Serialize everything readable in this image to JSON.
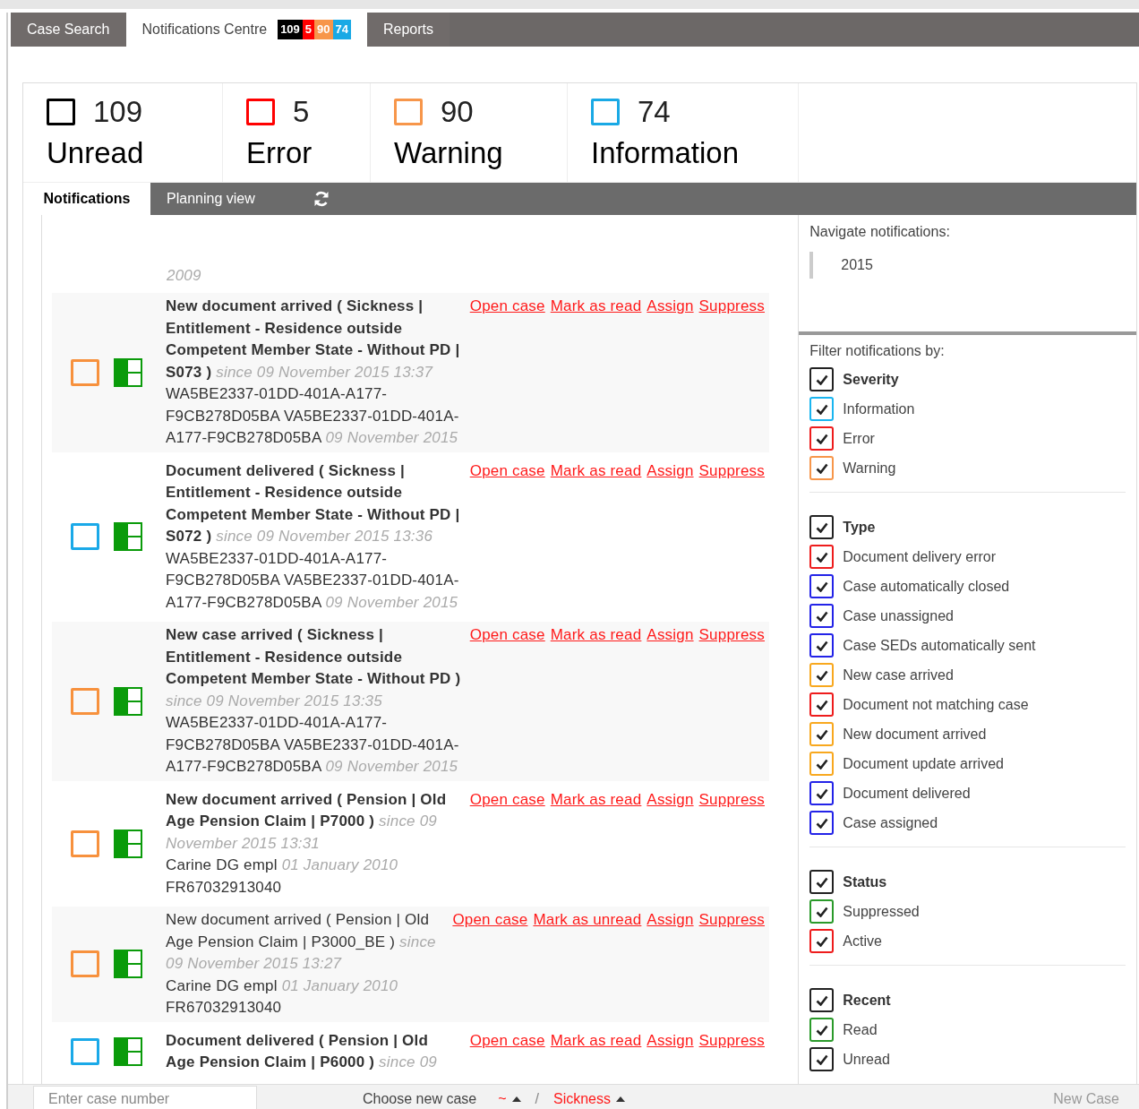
{
  "top_tabs": [
    {
      "label": "Case Search",
      "selected": false
    },
    {
      "label": "Notifications Centre",
      "selected": true,
      "badges": [
        {
          "text": "109",
          "color": "#000000"
        },
        {
          "text": "5",
          "color": "#ff0000"
        },
        {
          "text": "90",
          "color": "#f7964a"
        },
        {
          "text": "74",
          "color": "#19a9e5"
        }
      ]
    },
    {
      "label": "Reports",
      "selected": false
    }
  ],
  "stats": [
    {
      "count": "109",
      "label": "Unread",
      "color": "#000000"
    },
    {
      "count": "5",
      "label": "Error",
      "color": "#ff0000"
    },
    {
      "count": "90",
      "label": "Warning",
      "color": "#f7964a"
    },
    {
      "count": "74",
      "label": "Information",
      "color": "#19a9e5"
    }
  ],
  "sub_tabs": [
    {
      "label": "Notifications",
      "selected": true
    },
    {
      "label": "Planning view",
      "selected": false
    }
  ],
  "list_top_fragment": {
    "date": "2009"
  },
  "notifications": [
    {
      "color": "#f7913d",
      "unread": true,
      "title": "New document arrived ( Sickness | Entitlement - Residence outside Competent Member State - Without PD | S073 )",
      "since": "since 09 November 2015 13:37",
      "details": [
        {
          "text": "WA5BE2337-01DD-401A-A177-F9CB278D05BA VA5BE2337-01DD-401A-A177-F9CB278D05BA",
          "date": "09 November 2015"
        }
      ],
      "actions": [
        "Open case",
        "Mark as read",
        "Assign",
        "Suppress"
      ]
    },
    {
      "color": "#1aa9e8",
      "unread": true,
      "title": "Document delivered ( Sickness | Entitlement - Residence outside Competent Member State - Without PD | S072 )",
      "since": "since 09 November 2015 13:36",
      "details": [
        {
          "text": "WA5BE2337-01DD-401A-A177-F9CB278D05BA VA5BE2337-01DD-401A-A177-F9CB278D05BA",
          "date": "09 November 2015"
        }
      ],
      "actions": [
        "Open case",
        "Mark as read",
        "Assign",
        "Suppress"
      ]
    },
    {
      "color": "#f7913d",
      "unread": true,
      "title": "New case arrived ( Sickness | Entitlement - Residence outside Competent Member State - Without PD )",
      "since": "since 09 November 2015 13:35",
      "details": [
        {
          "text": "WA5BE2337-01DD-401A-A177-F9CB278D05BA VA5BE2337-01DD-401A-A177-F9CB278D05BA",
          "date": "09 November 2015"
        }
      ],
      "actions": [
        "Open case",
        "Mark as read",
        "Assign",
        "Suppress"
      ]
    },
    {
      "color": "#f7913d",
      "unread": true,
      "title": "New document arrived ( Pension | Old Age Pension Claim | P7000 )",
      "since": "since 09 November 2015 13:31",
      "details": [
        {
          "text": "Carine DG empl",
          "date": "01 January 2010"
        },
        {
          "text": "FR67032913040"
        }
      ],
      "actions": [
        "Open case",
        "Mark as read",
        "Assign",
        "Suppress"
      ]
    },
    {
      "color": "#f7913d",
      "unread": false,
      "title": "New document arrived ( Pension | Old Age Pension Claim | P3000_BE )",
      "since": "since 09 November 2015 13:27",
      "details": [
        {
          "text": "Carine DG empl",
          "date": "01 January 2010"
        },
        {
          "text": "FR67032913040"
        }
      ],
      "actions": [
        "Open case",
        "Mark as unread",
        "Assign",
        "Suppress"
      ]
    },
    {
      "color": "#1aa9e8",
      "unread": true,
      "title": "Document delivered ( Pension | Old Age Pension Claim | P6000 )",
      "since": "since 09",
      "actions": [
        "Open case",
        "Mark as read",
        "Assign",
        "Suppress"
      ]
    }
  ],
  "navigate": {
    "title": "Navigate notifications:",
    "years": [
      "2015"
    ]
  },
  "filters": {
    "title": "Filter notifications by:",
    "groups": [
      {
        "label": "Severity",
        "checked": true,
        "color": "#222222",
        "options": [
          {
            "label": "Information",
            "checked": true,
            "color": "#19b5f0"
          },
          {
            "label": "Error",
            "checked": true,
            "color": "#ee1c1c"
          },
          {
            "label": "Warning",
            "checked": true,
            "color": "#f7964a"
          }
        ]
      },
      {
        "label": "Type",
        "checked": true,
        "color": "#222222",
        "options": [
          {
            "label": "Document delivery error",
            "checked": true,
            "color": "#ee1c1c"
          },
          {
            "label": "Case automatically closed",
            "checked": true,
            "color": "#2323e8"
          },
          {
            "label": "Case unassigned",
            "checked": true,
            "color": "#2323e8"
          },
          {
            "label": "Case SEDs automatically sent",
            "checked": true,
            "color": "#2323e8"
          },
          {
            "label": "New case arrived",
            "checked": true,
            "color": "#f8a81e"
          },
          {
            "label": "Document not matching case",
            "checked": true,
            "color": "#ee1c1c"
          },
          {
            "label": "New document arrived",
            "checked": true,
            "color": "#f8a81e"
          },
          {
            "label": "Document update arrived",
            "checked": true,
            "color": "#f8a81e"
          },
          {
            "label": "Document delivered",
            "checked": true,
            "color": "#2323e8"
          },
          {
            "label": "Case assigned",
            "checked": true,
            "color": "#2323e8"
          }
        ]
      },
      {
        "label": "Status",
        "checked": true,
        "color": "#222222",
        "options": [
          {
            "label": "Suppressed",
            "checked": true,
            "color": "#2a9a2a"
          },
          {
            "label": "Active",
            "checked": true,
            "color": "#ee1c1c"
          }
        ]
      },
      {
        "label": "Recent",
        "checked": true,
        "color": "#222222",
        "options": [
          {
            "label": "Read",
            "checked": true,
            "color": "#2a9a2a"
          },
          {
            "label": "Unread",
            "checked": true,
            "color": "#222222"
          }
        ]
      }
    ]
  },
  "bottom_bar": {
    "case_number_placeholder": "Enter case number",
    "choose_label": "Choose new case",
    "breadcrumb": [
      "~",
      "Sickness"
    ],
    "breadcrumb_separator": "/",
    "new_case_button": "New Case"
  }
}
